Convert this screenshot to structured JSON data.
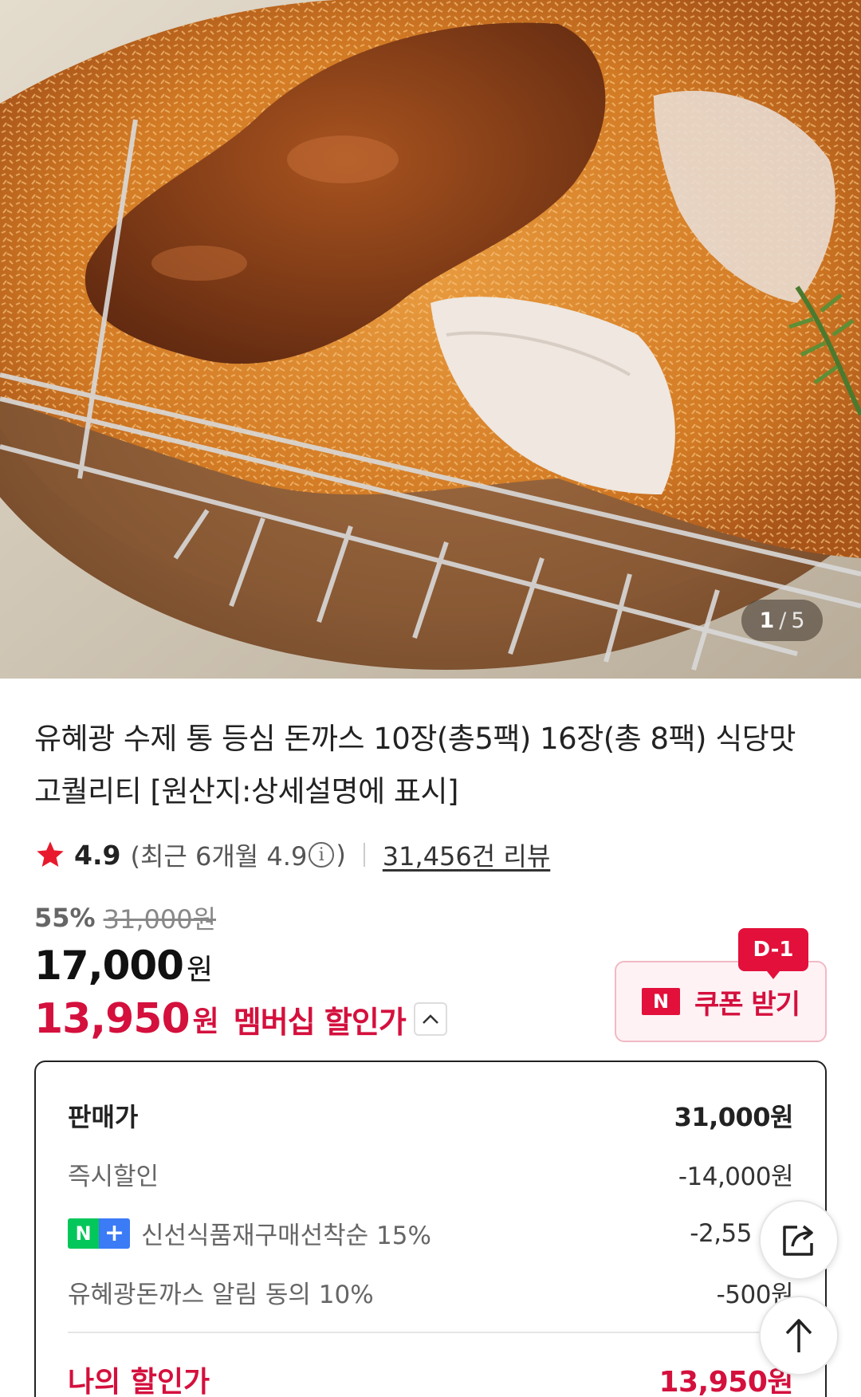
{
  "gallery": {
    "current": "1",
    "separator": "/",
    "total": "5"
  },
  "product": {
    "title": "유혜광 수제 통 등심 돈까스 10장(총5팩) 16장(총 8팩) 식당맛 고퀄리티 [원산지:상세설명에 표시]"
  },
  "rating": {
    "score": "4.9",
    "recent_prefix": "(최근 6개월 4.9",
    "recent_suffix": ")",
    "reviews_link": "31,456건 리뷰"
  },
  "price": {
    "discount_rate": "55%",
    "original": "31,000원",
    "sale_number": "17,000",
    "sale_unit": "원",
    "member_number": "13,950",
    "member_unit": "원",
    "member_label": "멤버십 할인가"
  },
  "coupon": {
    "badge": "D-1",
    "logo": "N",
    "label": "쿠폰 받기"
  },
  "breakdown": {
    "rows": [
      {
        "label": "판매가",
        "value": "31,000원"
      },
      {
        "label": "즉시할인",
        "value": "-14,000원"
      },
      {
        "label": "신선식품재구매선착순 15%",
        "value": "-2,55",
        "badge_n": "N",
        "badge_plus": "+"
      },
      {
        "label": "유혜광돈까스 알림 동의 10%",
        "value": "-500원"
      }
    ],
    "total_label": "나의 할인가",
    "total_value": "13,950원"
  },
  "icons": {
    "star": "star-icon",
    "info": "info-icon",
    "chevron": "chevron-up-icon",
    "share": "share-icon",
    "scroll_top": "arrow-up-icon"
  },
  "colors": {
    "accent": "#d4103d",
    "naver_red": "#e2103a",
    "naver_green": "#03c75a",
    "plus_blue": "#3b7bf6",
    "star": "#e8192c"
  }
}
